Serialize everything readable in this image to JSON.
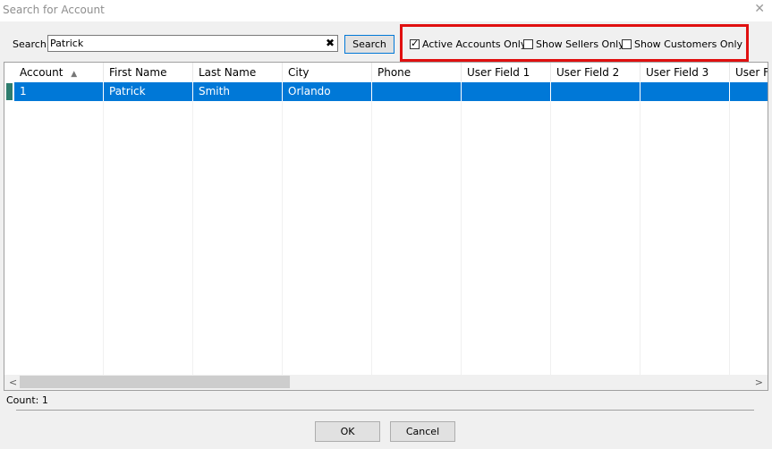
{
  "window": {
    "title": "Search for Account",
    "close_glyph": "✕"
  },
  "search": {
    "label": "Search",
    "value": "Patrick",
    "clear_glyph": "✖",
    "button_label": "Search"
  },
  "filters": {
    "active_accounts_only": {
      "label": "Active Accounts Only",
      "checked": true
    },
    "show_sellers_only": {
      "label": "Show Sellers Only",
      "checked": false
    },
    "show_customers_only": {
      "label": "Show Customers Only",
      "checked": false
    }
  },
  "table": {
    "columns": [
      "Account",
      "First Name",
      "Last Name",
      "City",
      "Phone",
      "User Field 1",
      "User Field 2",
      "User Field 3",
      "User F"
    ],
    "sort_glyph": "▲",
    "rows": [
      {
        "account": "1",
        "first_name": "Patrick",
        "last_name": "Smith",
        "city": "Orlando",
        "phone": "",
        "user_field_1": "",
        "user_field_2": "",
        "user_field_3": "",
        "user_f": ""
      }
    ]
  },
  "status": {
    "count": "Count: 1"
  },
  "buttons": {
    "ok": "OK",
    "cancel": "Cancel"
  },
  "colors": {
    "selection": "#0078d7",
    "highlight_border": "#e01010"
  }
}
